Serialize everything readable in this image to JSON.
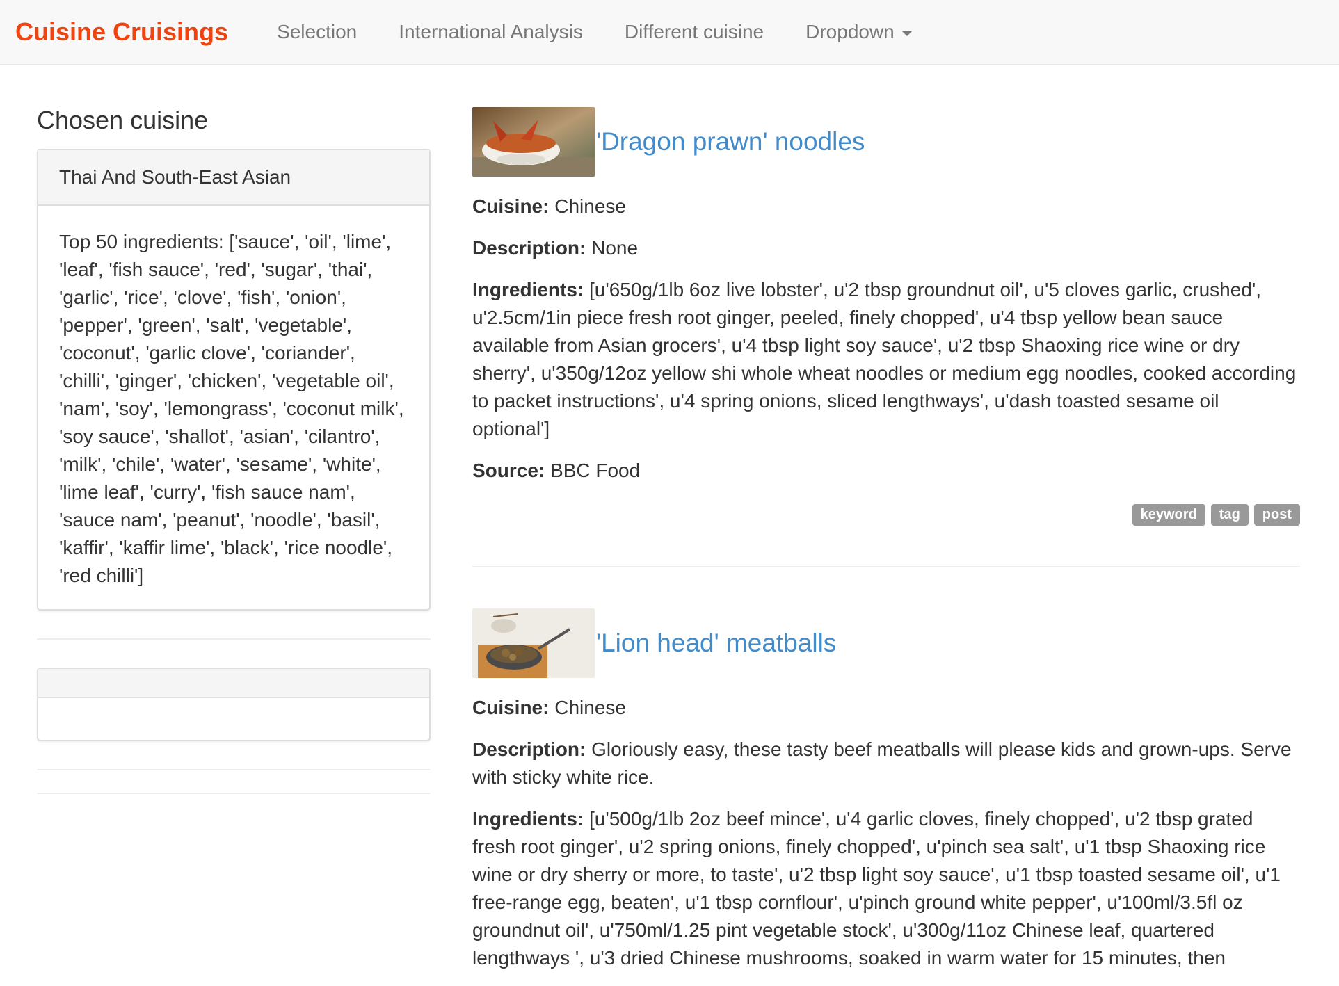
{
  "navbar": {
    "brand": "Cuisine Cruisings",
    "items": [
      "Selection",
      "International Analysis",
      "Different cuisine",
      "Dropdown"
    ]
  },
  "sidebar": {
    "heading": "Chosen cuisine",
    "panel_title": "Thai And South-East Asian",
    "panel_body": "Top 50 ingredients: ['sauce', 'oil', 'lime', 'leaf', 'fish sauce', 'red', 'sugar', 'thai', 'garlic', 'rice', 'clove', 'fish', 'onion', 'pepper', 'green', 'salt', 'vegetable', 'coconut', 'garlic clove', 'coriander', 'chilli', 'ginger', 'chicken', 'vegetable oil', 'nam', 'soy', 'lemongrass', 'coconut milk', 'soy sauce', 'shallot', 'asian', 'cilantro', 'milk', 'chile', 'water', 'sesame', 'white', 'lime leaf', 'curry', 'fish sauce nam', 'sauce nam', 'peanut', 'noodle', 'basil', 'kaffir', 'kaffir lime', 'black', 'rice noodle', 'red chilli']"
  },
  "labels": {
    "cuisine": "Cuisine:",
    "description": "Description:",
    "ingredients": "Ingredients:",
    "source": "Source:"
  },
  "recipes": [
    {
      "title": "'Dragon prawn' noodles",
      "cuisine": "Chinese",
      "description": "None",
      "ingredients": "[u'650g/1lb 6oz live lobster', u'2 tbsp groundnut oil', u'5 cloves garlic, crushed', u'2.5cm/1in piece fresh root ginger, peeled, finely chopped', u'4 tbsp yellow bean sauce available from Asian grocers', u'4 tbsp light soy sauce', u'2 tbsp Shaoxing rice wine or dry sherry', u'350g/12oz yellow shi whole wheat noodles or medium egg noodles, cooked according to packet instructions', u'4 spring onions, sliced lengthways', u'dash toasted sesame oil optional']",
      "source": "BBC Food",
      "tags": [
        "keyword",
        "tag",
        "post"
      ]
    },
    {
      "title": "'Lion head' meatballs",
      "cuisine": "Chinese",
      "description": "Gloriously easy, these tasty beef meatballs will please kids and grown-ups. Serve with sticky white rice.",
      "ingredients": "[u'500g/1lb 2oz beef mince', u'4 garlic cloves, finely chopped', u'2 tbsp grated fresh root ginger', u'2 spring onions, finely chopped', u'pinch sea salt', u'1 tbsp Shaoxing rice wine or dry sherry or more, to taste', u'2 tbsp light soy sauce', u'1 tbsp toasted sesame oil', u'1 free-range egg, beaten', u'1 tbsp cornflour', u'pinch ground white pepper', u'100ml/3.5fl oz groundnut oil', u'750ml/1.25 pint vegetable stock', u'300g/11oz Chinese leaf, quartered lengthways ', u'3 dried Chinese mushrooms, soaked in warm water for 15 minutes, then"
    }
  ]
}
